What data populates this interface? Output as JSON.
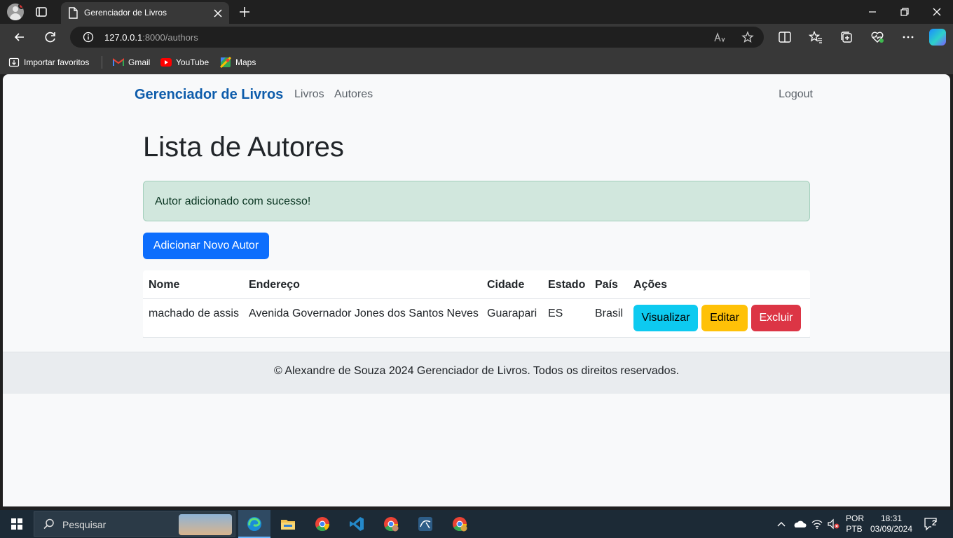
{
  "browser": {
    "tab_title": "Gerenciador de Livros",
    "url_host": "127.0.0.1",
    "url_rest": ":8000/authors",
    "favorites": [
      {
        "label": "Importar favoritos",
        "icon": "import-favorites-icon"
      },
      {
        "label": "Gmail",
        "icon": "gmail-icon"
      },
      {
        "label": "YouTube",
        "icon": "youtube-icon"
      },
      {
        "label": "Maps",
        "icon": "maps-icon"
      }
    ]
  },
  "navbar": {
    "brand": "Gerenciador de Livros",
    "links": [
      "Livros",
      "Autores"
    ],
    "logout": "Logout"
  },
  "main": {
    "title": "Lista de Autores",
    "alert": "Autor adicionado com sucesso!",
    "add_button": "Adicionar Novo Autor"
  },
  "table": {
    "headers": [
      "Nome",
      "Endereço",
      "Cidade",
      "Estado",
      "País",
      "Ações"
    ],
    "rows": [
      {
        "nome": "machado de assis",
        "endereco": "Avenida Governador Jones dos Santos Neves",
        "cidade": "Guarapari",
        "estado": "ES",
        "pais": "Brasil",
        "actions": [
          "Visualizar",
          "Editar",
          "Excluir"
        ]
      }
    ]
  },
  "footer": {
    "text": "© Alexandre de Souza 2024 Gerenciador de Livros. Todos os direitos reservados."
  },
  "taskbar": {
    "search_placeholder": "Pesquisar",
    "lang_top": "POR",
    "lang_bottom": "PTB",
    "time": "18:31",
    "date": "03/09/2024",
    "notification_count": "2"
  },
  "colors": {
    "brand": "#0d5cab",
    "primary": "#0d6efd",
    "info": "#0dcaf0",
    "warning": "#ffc107",
    "danger": "#dc3545",
    "alert_bg": "#d1e7dd"
  }
}
